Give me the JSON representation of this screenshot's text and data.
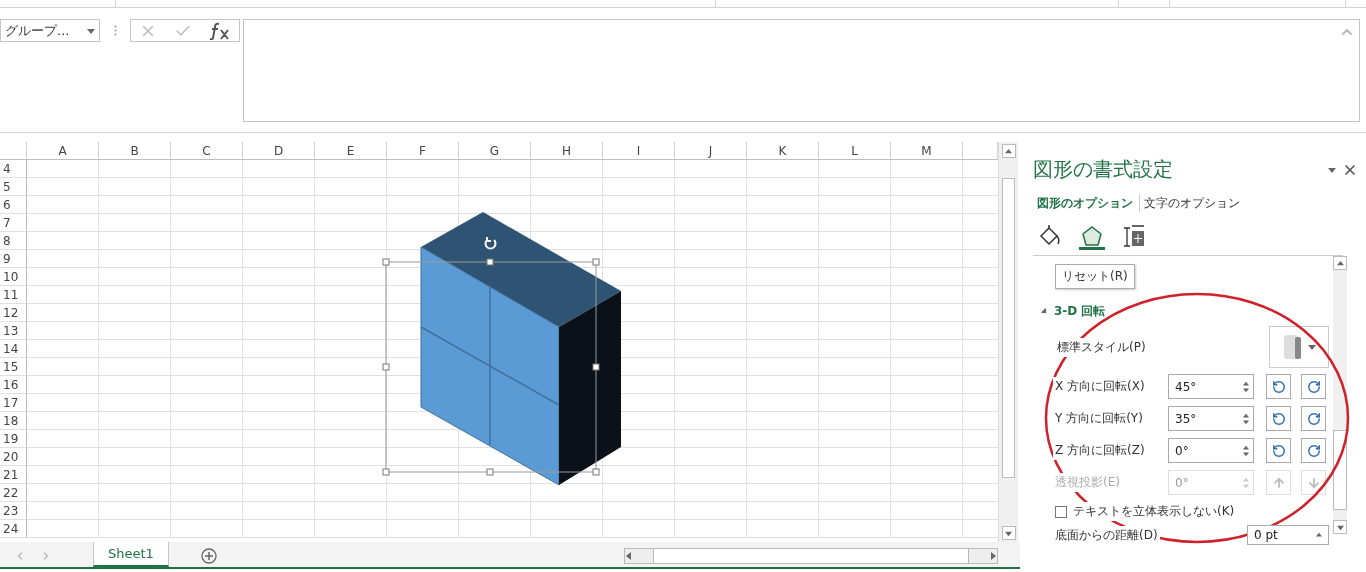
{
  "name_box": {
    "value": "グループ..."
  },
  "columns": [
    "A",
    "B",
    "C",
    "D",
    "E",
    "F",
    "G",
    "H",
    "I",
    "J",
    "K",
    "L",
    "M"
  ],
  "rows": [
    "4",
    "5",
    "6",
    "7",
    "8",
    "9",
    "10",
    "11",
    "12",
    "13",
    "14",
    "15",
    "16",
    "17",
    "18",
    "19",
    "20",
    "21",
    "22",
    "23",
    "24"
  ],
  "sheet_tabs": [
    {
      "label": "Sheet1",
      "selected": true
    }
  ],
  "format_pane": {
    "title": "図形の書式設定",
    "tabs": [
      {
        "label": "図形のオプション",
        "selected": true
      },
      {
        "label": "文字のオプション",
        "selected": false
      }
    ],
    "icon_tabs": [
      {
        "kind": "fill",
        "selected": false
      },
      {
        "kind": "effects",
        "selected": true
      },
      {
        "kind": "size",
        "selected": false
      }
    ],
    "tooltip": "リセット(R)",
    "section": {
      "title": "3-D 回転",
      "expanded": true
    },
    "preset_label": "標準スタイル(P)",
    "rotations": [
      {
        "label": "X 方向に回転(X)",
        "value": "45°",
        "disabled": false,
        "kind": "x"
      },
      {
        "label": "Y 方向に回転(Y)",
        "value": "35°",
        "disabled": false,
        "kind": "y"
      },
      {
        "label": "Z 方向に回転(Z)",
        "value": "0°",
        "disabled": false,
        "kind": "z"
      },
      {
        "label": "透視投影(E)",
        "value": "0°",
        "disabled": true,
        "kind": "perspective"
      }
    ],
    "keep_flat": {
      "label": "テキストを立体表示しない(K)",
      "checked": false
    },
    "distance": {
      "label": "底面からの距離(D)",
      "value": "0 pt"
    }
  }
}
